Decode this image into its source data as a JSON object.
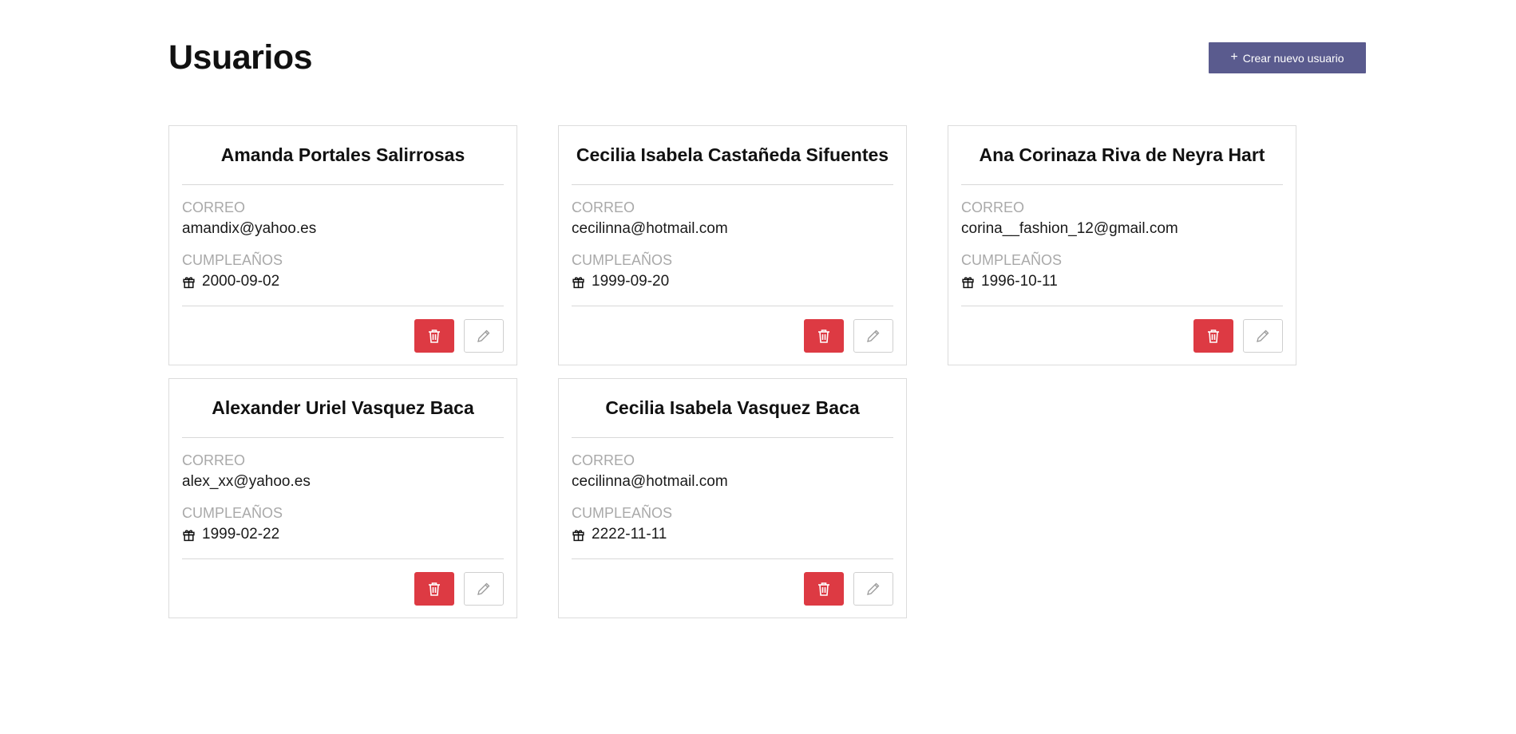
{
  "page": {
    "title": "Usuarios"
  },
  "actions": {
    "create_label": "Crear nuevo usuario",
    "create_icon": "plus-icon"
  },
  "labels": {
    "email": "CORREO",
    "birthday": "CUMPLEAÑOS"
  },
  "icons": {
    "birthday": "gift-icon",
    "delete": "trash-icon",
    "edit": "pencil-icon"
  },
  "colors": {
    "primary": "#5a5b8e",
    "danger": "#dd3a43",
    "muted_label": "#a9a9a9",
    "border": "#dcdcdc"
  },
  "users": [
    {
      "name": "Amanda Portales Salirrosas",
      "email": "amandix@yahoo.es",
      "birthday": "2000-09-02"
    },
    {
      "name": "Cecilia Isabela Castañeda Sifuentes",
      "email": "cecilinna@hotmail.com",
      "birthday": "1999-09-20"
    },
    {
      "name": "Ana Corinaza Riva de Neyra Hart",
      "email": "corina__fashion_12@gmail.com",
      "birthday": "1996-10-11"
    },
    {
      "name": "Alexander Uriel Vasquez Baca",
      "email": "alex_xx@yahoo.es",
      "birthday": "1999-02-22"
    },
    {
      "name": "Cecilia Isabela Vasquez Baca",
      "email": "cecilinna@hotmail.com",
      "birthday": "2222-11-11"
    }
  ]
}
